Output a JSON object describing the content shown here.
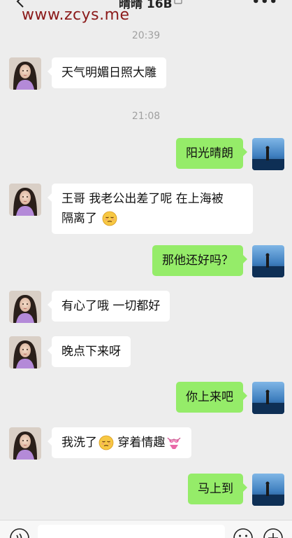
{
  "header": {
    "watermark": "www.zcys.me",
    "title": "晴晴 16B"
  },
  "messages": [
    {
      "type": "time",
      "text": "20:39"
    },
    {
      "type": "in",
      "text": "天气明媚日照大雕"
    },
    {
      "type": "time",
      "text": "21:08"
    },
    {
      "type": "out",
      "text": "阳光晴朗"
    },
    {
      "type": "in",
      "line1": "王哥 我老公出差了呢 在上海被",
      "line2": "隔离了",
      "emoji": "pensive-emoji"
    },
    {
      "type": "out",
      "text": "那他还好吗？"
    },
    {
      "type": "in",
      "text": "有心了哦 一切都好"
    },
    {
      "type": "in",
      "text": "晚点下来呀"
    },
    {
      "type": "out",
      "text": "你上来吧"
    },
    {
      "type": "in",
      "text_before": "我洗了",
      "emoji1": "pensive-emoji",
      "text_after": " 穿着情趣",
      "emoji2": "bikini-emoji"
    },
    {
      "type": "out",
      "text": "马上到"
    }
  ],
  "colors": {
    "background": "#ededed",
    "incoming_bubble": "#ffffff",
    "outgoing_bubble": "#95ec69",
    "watermark": "#8b1a1a"
  },
  "icons": {
    "back": "back-icon",
    "more": "more-icon",
    "device": "device-icon",
    "voice": "voice-icon",
    "emoji": "emoji-icon",
    "plus": "plus-icon"
  }
}
